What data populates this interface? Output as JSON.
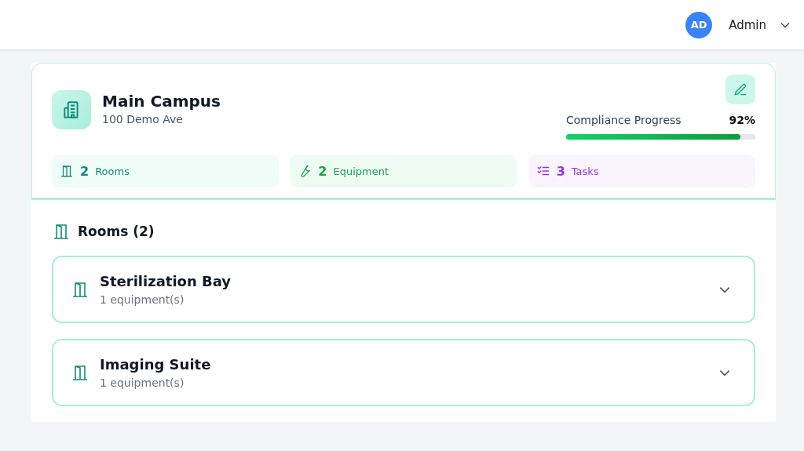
{
  "header": {
    "user": {
      "initials": "AD",
      "name": "Admin"
    }
  },
  "location": {
    "name": "Main Campus",
    "address": "100 Demo Ave",
    "compliance": {
      "label": "Compliance Progress",
      "reading": "92%",
      "level": 0.92
    },
    "stats": [
      {
        "kind": "rooms",
        "count": "2",
        "label": "Rooms",
        "color": "#0f8a7a"
      },
      {
        "kind": "equipment",
        "count": "2",
        "label": "Equipment",
        "color": "#16a34a"
      },
      {
        "kind": "tasks",
        "count": "3",
        "label": "Tasks",
        "color": "#9333ea"
      }
    ]
  },
  "rooms_section": {
    "title": "Rooms (2)",
    "rooms": [
      {
        "name": "Sterilization Bay",
        "detail": "1 equipment(s)"
      },
      {
        "name": "Imaging Suite",
        "detail": "1 equipment(s)"
      }
    ]
  }
}
